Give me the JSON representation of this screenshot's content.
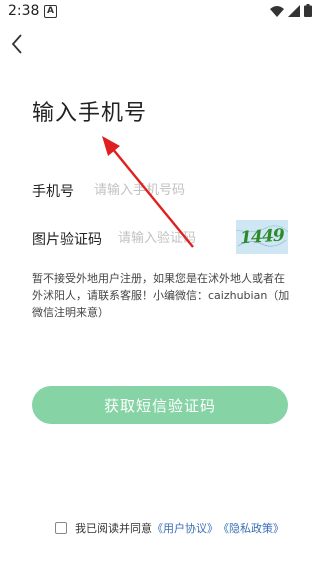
{
  "status_bar": {
    "time": "2:38",
    "alert_glyph": "A"
  },
  "page": {
    "title": "输入手机号"
  },
  "phone": {
    "label": "手机号",
    "placeholder": "请输入手机号码",
    "value": ""
  },
  "captcha": {
    "label": "图片验证码",
    "placeholder": "请输入验证码",
    "value": "",
    "image_text": "1449"
  },
  "notice": "暂不接受外地用户注册，如果您是在沭外地人或者在外沭阳人，请联系客服！小编微信：caizhubian（加微信注明来意）",
  "submit_label": "获取短信验证码",
  "agreement": {
    "prefix": "我已阅读并同意",
    "user_agreement": "《用户协议》",
    "privacy_policy": "《隐私政策》",
    "checked": false
  },
  "colors": {
    "button": "#86d4a6",
    "arrow": "#e02020",
    "link": "#3a6fb5"
  }
}
